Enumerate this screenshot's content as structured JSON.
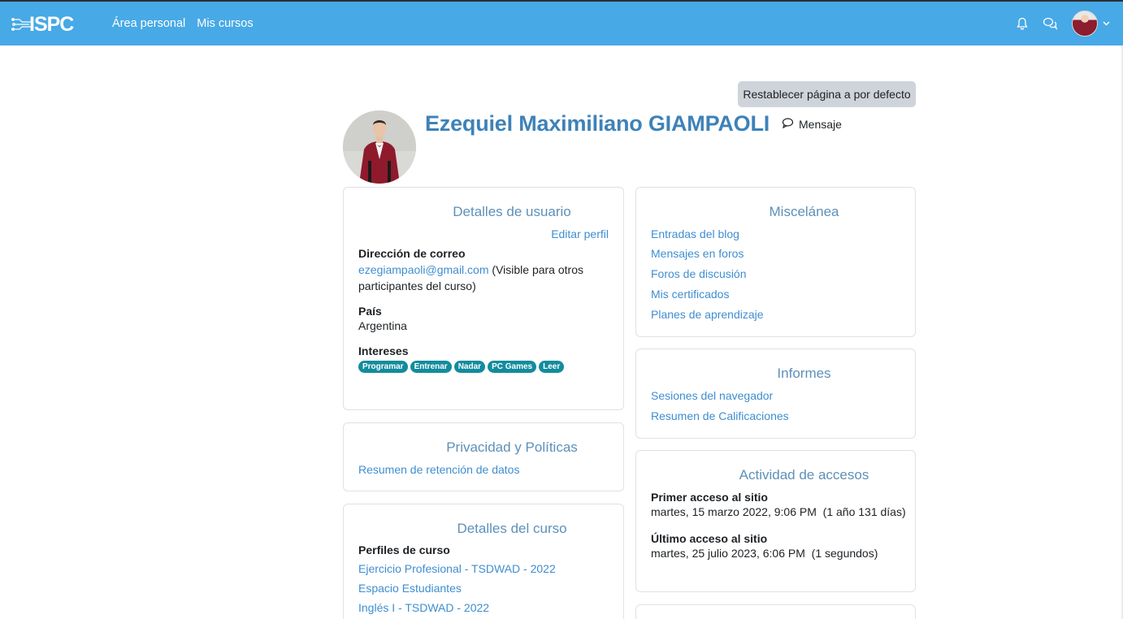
{
  "topbar": {
    "logo_text": "ISPC",
    "nav": [
      "Área personal",
      "Mis cursos"
    ]
  },
  "page": {
    "reset_label": "Restablecer página a por defecto",
    "user_name": "Ezequiel Maximiliano GIAMPAOLI",
    "message_label": "Mensaje"
  },
  "user_details": {
    "title": "Detalles de usuario",
    "edit_label": "Editar perfil",
    "email_label": "Dirección de correo",
    "email": "ezegiampaoli@gmail.com",
    "email_note_1": "(Visible para otros",
    "email_note_2": "participantes del curso)",
    "country_label": "País",
    "country": "Argentina",
    "interests_label": "Intereses",
    "interests": [
      "Programar",
      "Entrenar",
      "Nadar",
      "PC Games",
      "Leer"
    ]
  },
  "privacy": {
    "title": "Privacidad y Políticas",
    "link": "Resumen de retención de datos"
  },
  "course_details": {
    "title": "Detalles del curso",
    "profiles_label": "Perfiles de curso",
    "courses": [
      "Ejercicio Profesional - TSDWAD - 2022",
      "Espacio Estudiantes",
      "Inglés I - TSDWAD - 2022"
    ]
  },
  "misc": {
    "title": "Miscelánea",
    "links": [
      "Entradas del blog",
      "Mensajes en foros",
      "Foros de discusión",
      "Mis certificados",
      "Planes de aprendizaje"
    ]
  },
  "reports": {
    "title": "Informes",
    "links": [
      "Sesiones del navegador",
      "Resumen de Calificaciones"
    ]
  },
  "access": {
    "title": "Actividad de accesos",
    "first_label": "Primer acceso al sitio",
    "first_value": "martes, 15 marzo 2022, 9:06 PM  (1 año 131 días)",
    "last_label": "Último acceso al sitio",
    "last_value": "martes, 25 julio 2023, 6:06 PM  (1 segundos)"
  },
  "colors": {
    "topbar": "#47a9e6",
    "link": "#3f8ed0",
    "badge": "#128c9d",
    "name": "#3e82b8"
  }
}
